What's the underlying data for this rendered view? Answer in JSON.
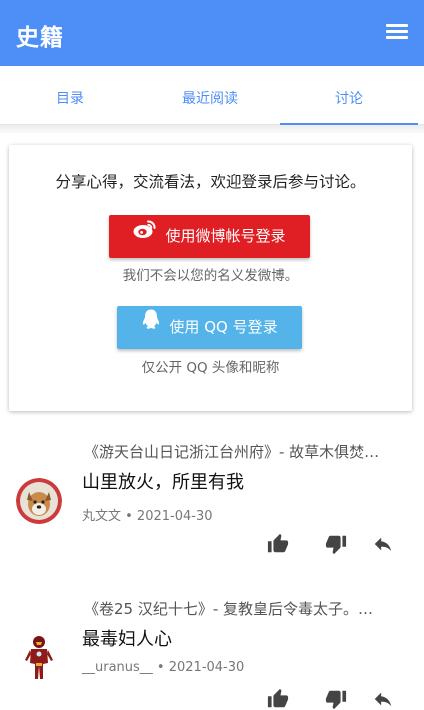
{
  "app": {
    "title": "史籍",
    "menu_icon": "menu-icon"
  },
  "tabs": [
    {
      "label": "目录",
      "active": false
    },
    {
      "label": "最近阅读",
      "active": false
    },
    {
      "label": "讨论",
      "active": true
    }
  ],
  "login_card": {
    "intro": "分享心得，交流看法，欢迎登录后参与讨论。",
    "weibo_button": "使用微博帐号登录",
    "weibo_note": "我们不会以您的名义发微博。",
    "qq_button": "使用 QQ 号登录",
    "qq_note": "仅公开 QQ 头像和昵称"
  },
  "comments": [
    {
      "source": "《游天台山日记浙江台州府》- 故草木俱焚…",
      "text": "山里放火，所里有我",
      "author": "丸文文",
      "date": "2021-04-30",
      "meta": "丸文文 • 2021-04-30"
    },
    {
      "source": "《卷25 汉纪十七》- 复教皇后令毒太子。…",
      "text": "最毒妇人心",
      "author": "__uranus__",
      "date": "2021-04-30",
      "meta": "__uranus__ • 2021-04-30"
    }
  ],
  "colors": {
    "primary": "#4d8ef7",
    "weibo": "#df1f24",
    "qq": "#54b4ea",
    "action_icon": "#444444"
  },
  "icons": {
    "like": "thumb-up-icon",
    "dislike": "thumb-down-icon",
    "reply": "reply-icon",
    "weibo": "weibo-icon",
    "qq": "qq-icon"
  }
}
